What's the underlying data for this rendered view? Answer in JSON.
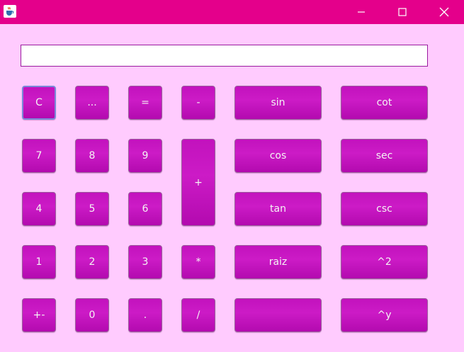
{
  "window": {
    "title": "",
    "app_icon": "java-cup-icon",
    "controls": [
      "minimize-icon",
      "maximize-icon",
      "close-icon"
    ]
  },
  "colors": {
    "titlebar": "#e4008b",
    "background": "#ffcbfe",
    "button": "#c414bf",
    "button_text": "#f4f4f4"
  },
  "display": {
    "value": ""
  },
  "buttons": {
    "clear": "C",
    "ellipsis": "...",
    "equals": "=",
    "minus": "-",
    "sin": "sin",
    "cot": "cot",
    "seven": "7",
    "eight": "8",
    "nine": "9",
    "plus": "+",
    "cos": "cos",
    "sec": "sec",
    "four": "4",
    "five": "5",
    "six": "6",
    "tan": "tan",
    "csc": "csc",
    "one": "1",
    "two": "2",
    "three": "3",
    "multiply": "*",
    "sqrt": "raiz",
    "square": "^2",
    "plus_minus": "+-",
    "zero": "0",
    "decimal": ".",
    "divide": "/",
    "blank": "",
    "power": "^y"
  }
}
